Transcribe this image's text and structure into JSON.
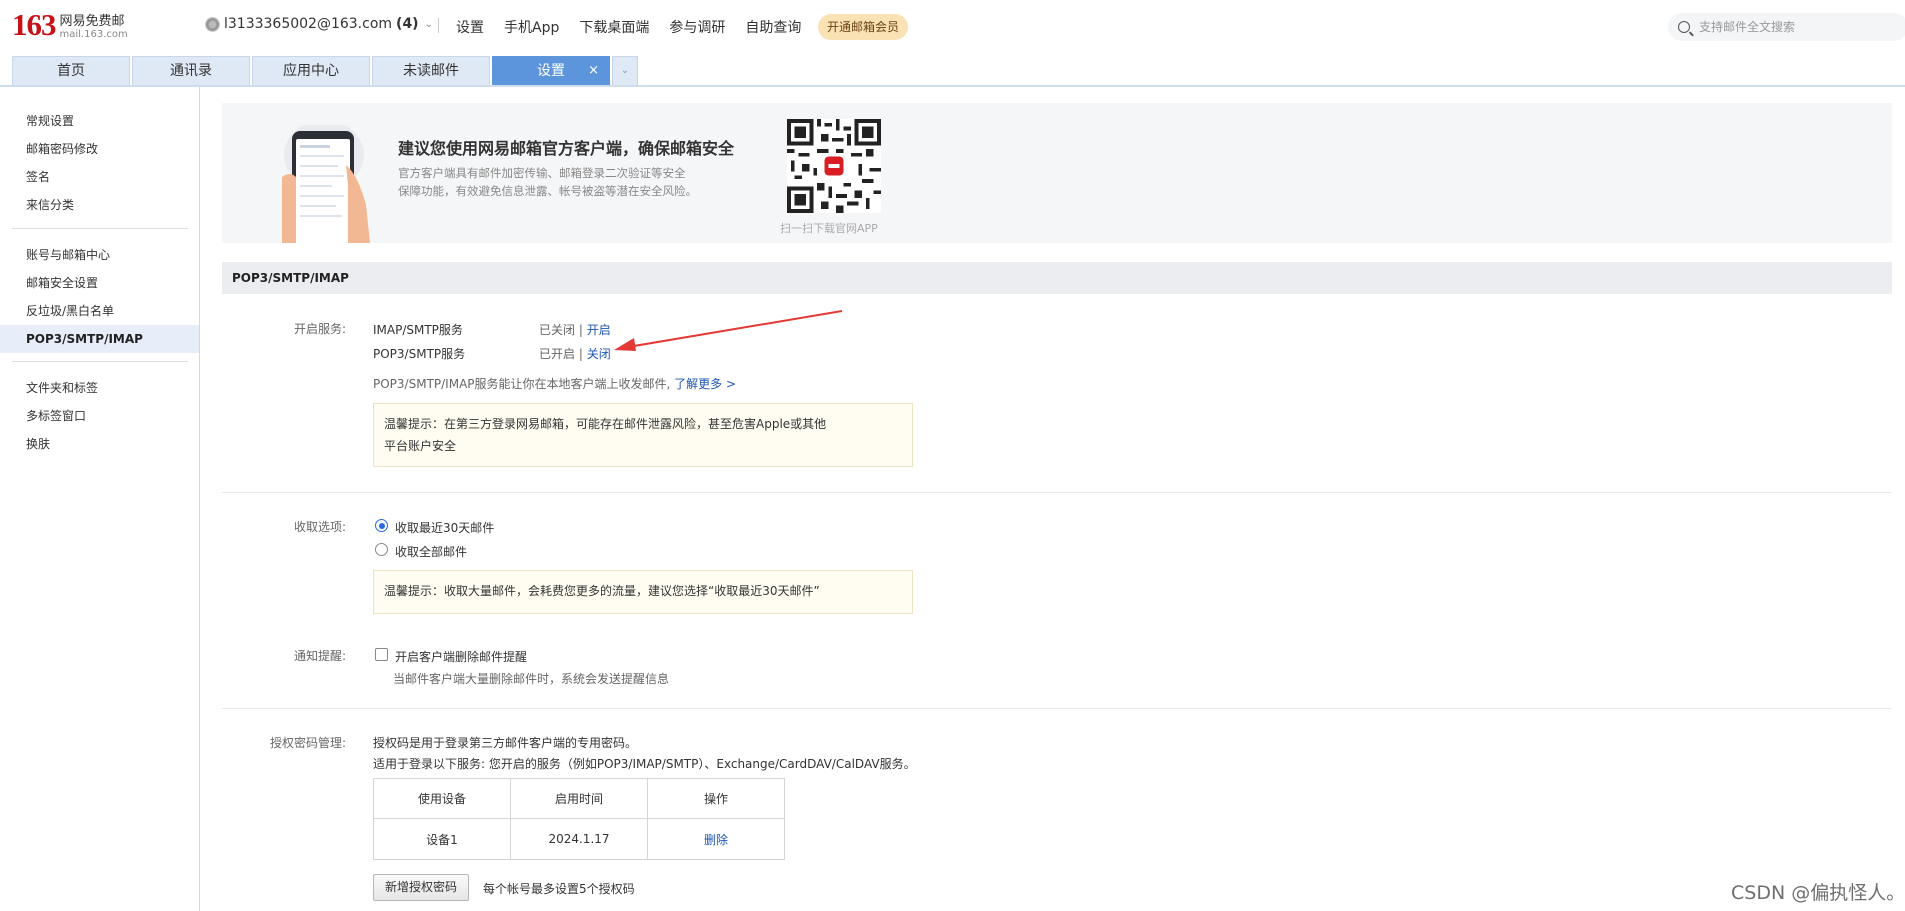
{
  "header": {
    "logo_number": "163",
    "logo_name": "网易免费邮",
    "logo_domain": "mail.163.com",
    "account": "l3133365002@163.com",
    "unread_count": "(4)",
    "nav": [
      "设置",
      "手机App",
      "下载桌面端",
      "参与调研",
      "自助查询"
    ],
    "vip_button": "开通邮箱会员",
    "search_placeholder": "支持邮件全文搜索"
  },
  "tabs": [
    {
      "label": "首页"
    },
    {
      "label": "通讯录"
    },
    {
      "label": "应用中心"
    },
    {
      "label": "未读邮件"
    },
    {
      "label": "设置",
      "active": true,
      "close": "×"
    }
  ],
  "sidebar": {
    "groups": [
      [
        "常规设置",
        "邮箱密码修改",
        "签名",
        "来信分类"
      ],
      [
        "账号与邮箱中心",
        "邮箱安全设置",
        "反垃圾/黑白名单",
        "POP3/SMTP/IMAP"
      ],
      [
        "文件夹和标签",
        "多标签窗口",
        "换肤"
      ]
    ],
    "active_item": "POP3/SMTP/IMAP"
  },
  "banner": {
    "title": "建议您使用网易邮箱官方客户端，确保邮箱安全",
    "desc_line1": "官方客户端具有邮件加密传输、邮箱登录二次验证等安全",
    "desc_line2": "保障功能，有效避免信息泄露、帐号被盗等潜在安全风险。",
    "qr_caption": "扫一扫下载官网APP"
  },
  "section_title": "POP3/SMTP/IMAP",
  "services": {
    "label": "开启服务:",
    "items": [
      {
        "name": "IMAP/SMTP服务",
        "status": "已关闭",
        "sep": "|",
        "action": "开启"
      },
      {
        "name": "POP3/SMTP服务",
        "status": "已开启",
        "sep": "|",
        "action": "关闭"
      }
    ],
    "desc": "POP3/SMTP/IMAP服务能让你在本地客户端上收发邮件,",
    "learn_more": "了解更多 >",
    "notice_line1": "温馨提示：在第三方登录网易邮箱，可能存在邮件泄露风险，甚至危害Apple或其他",
    "notice_line2": "平台账户安全"
  },
  "receive": {
    "label": "收取选项:",
    "options": [
      {
        "label": "收取最近30天邮件",
        "checked": true
      },
      {
        "label": "收取全部邮件",
        "checked": false
      }
    ],
    "notice": "温馨提示：收取大量邮件，会耗费您更多的流量，建议您选择“收取最近30天邮件”"
  },
  "notify": {
    "label": "通知提醒:",
    "checkbox_label": "开启客户端删除邮件提醒",
    "checked": false,
    "hint": "当邮件客户端大量删除邮件时，系统会发送提醒信息"
  },
  "auth_code": {
    "label": "授权密码管理:",
    "desc1": "授权码是用于登录第三方邮件客户端的专用密码。",
    "desc2": "适用于登录以下服务: 您开启的服务（例如POP3/IMAP/SMTP）、Exchange/CardDAV/CalDAV服务。",
    "columns": [
      "使用设备",
      "启用时间",
      "操作"
    ],
    "rows": [
      {
        "device": "设备1",
        "date": "2024.1.17",
        "action": "删除"
      }
    ],
    "add_button": "新增授权密码",
    "limit_note": "每个帐号最多设置5个授权码"
  },
  "watermark": "CSDN @偏执怪人。",
  "colors": {
    "brand_red": "#c6131a",
    "tab_active": "#5c95dc",
    "link": "#1d56b2",
    "annotation_arrow": "#e53935"
  }
}
